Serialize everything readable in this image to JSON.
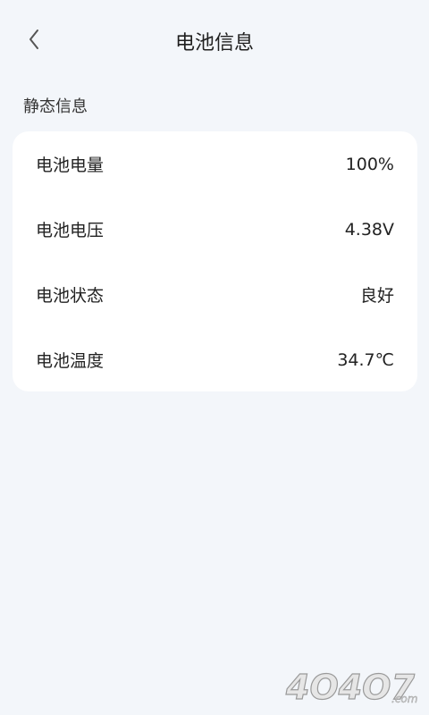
{
  "header": {
    "title": "电池信息",
    "back_icon": "chevron-left-icon"
  },
  "section": {
    "title": "静态信息"
  },
  "rows": [
    {
      "label": "电池电量",
      "value": "100%"
    },
    {
      "label": "电池电压",
      "value": "4.38V"
    },
    {
      "label": "电池状态",
      "value": "良好"
    },
    {
      "label": "电池温度",
      "value": "34.7℃"
    }
  ],
  "watermark": {
    "text": "4O4O7.com"
  },
  "colors": {
    "background": "#f3f6fa",
    "card": "#ffffff",
    "text": "#222222"
  }
}
